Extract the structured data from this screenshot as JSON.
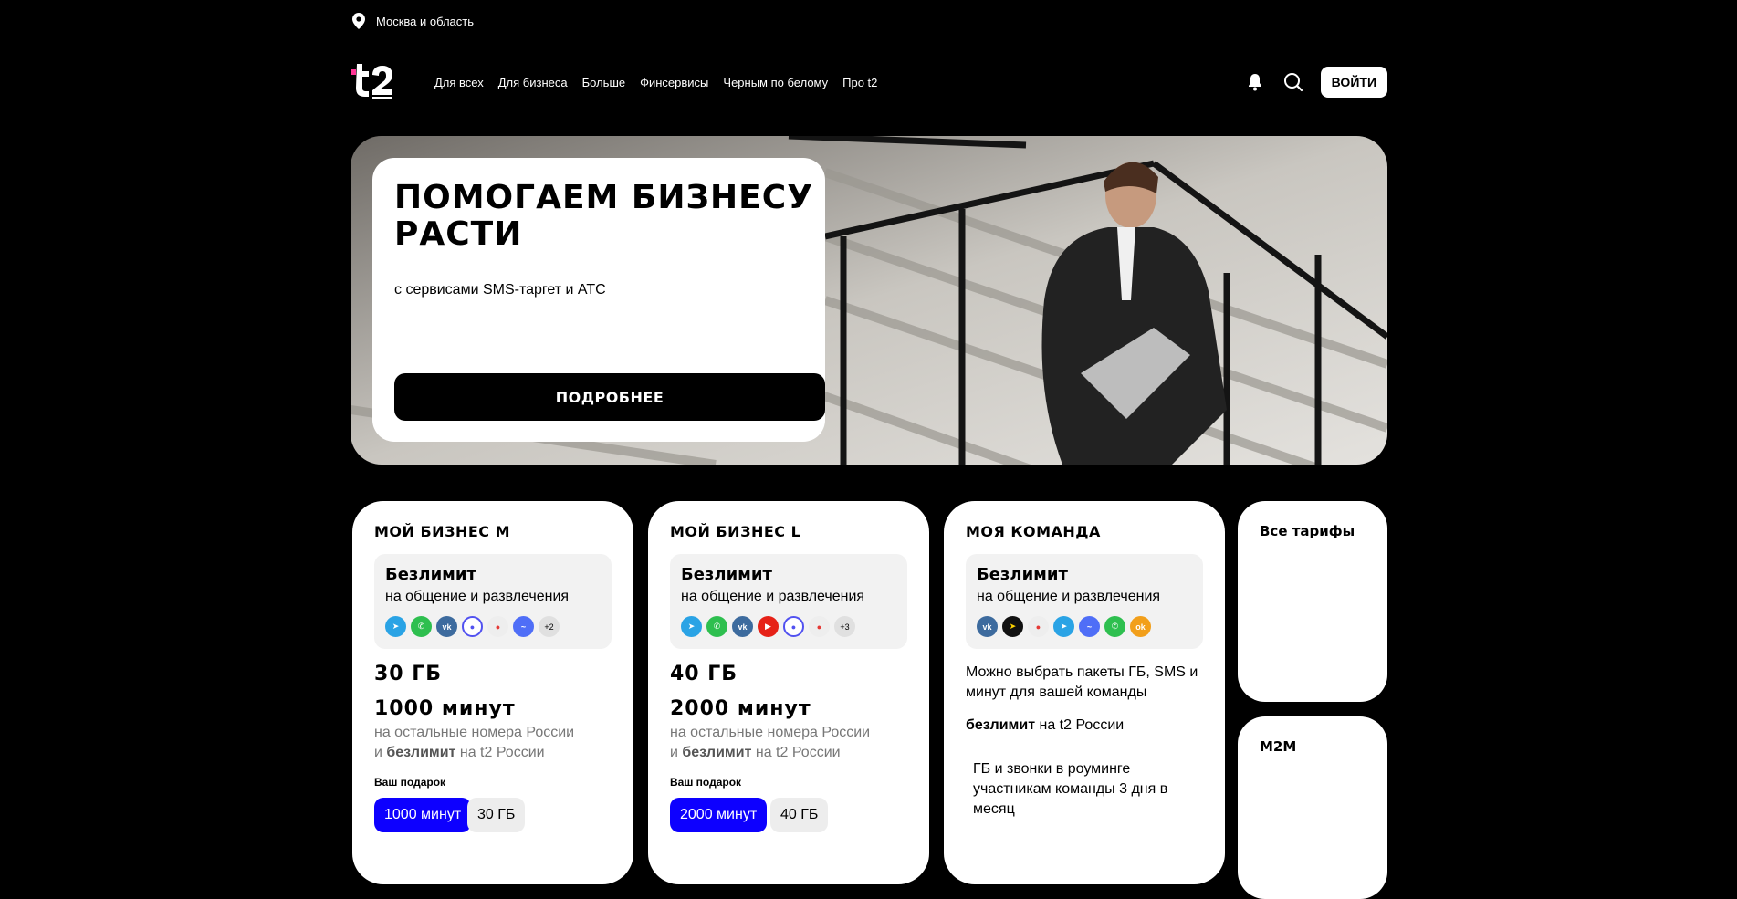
{
  "region": {
    "label": "Москва и область"
  },
  "header": {
    "nav": [
      "Для всех",
      "Для бизнеса",
      "Больше",
      "Финсервисы",
      "Черным по белому",
      "Про t2"
    ],
    "login_label": "ВОЙТИ",
    "icons": [
      "location-pin-icon",
      "t2-logo",
      "bell-icon",
      "search-icon"
    ]
  },
  "hero": {
    "title": "ПОМОГАЕМ БИЗНЕСУ РАСТИ",
    "subtitle": "с сервисами SMS-таргет и АТС",
    "button": "ПОДРОБНЕЕ"
  },
  "tariffs": [
    {
      "name": "МОЙ БИЗНЕС М",
      "unlim_title": "Безлимит",
      "unlim_sub": "на общение и развлечения",
      "apps": [
        "telegram",
        "whatsapp",
        "vk",
        "max",
        "maps",
        "messenger"
      ],
      "apps_more": "+2",
      "gb": "30 ГБ",
      "minutes": "1000 минут",
      "minutes_desc_1": "на остальные номера России",
      "minutes_desc_2a": "и ",
      "minutes_desc_bold": "безлимит",
      "minutes_desc_2b": " на t2 России",
      "gift_label": "Ваш подарок",
      "gift_a": "1000 минут",
      "gift_b": "30 ГБ"
    },
    {
      "name": "МОЙ БИЗНЕС L",
      "unlim_title": "Безлимит",
      "unlim_sub": "на общение и развлечения",
      "apps": [
        "telegram",
        "whatsapp",
        "vk",
        "youtube",
        "max",
        "maps"
      ],
      "apps_more": "+3",
      "gb": "40 ГБ",
      "minutes": "2000 минут",
      "minutes_desc_1": "на остальные номера России",
      "minutes_desc_2a": "и ",
      "minutes_desc_bold": "безлимит",
      "minutes_desc_2b": " на t2 России",
      "gift_label": "Ваш подарок",
      "gift_a": "2000 минут",
      "gift_b": "40 ГБ"
    },
    {
      "name": "МОЯ КОМАНДА",
      "unlim_title": "Безлимит",
      "unlim_sub": "на общение и развлечения",
      "apps": [
        "vk",
        "navigator",
        "maps",
        "telegram",
        "messenger",
        "whatsapp",
        "ok"
      ],
      "text": "Можно выбрать пакеты ГБ, SMS и минут для вашей команды",
      "unlim_bold": "безлимит",
      "unlim_rest": " на t2 России",
      "roaming": "ГБ и звонки в роуминге участникам команды 3 дня в месяц"
    }
  ],
  "side": {
    "all_tariffs": "Все тарифы",
    "m2m": "M2M"
  },
  "colors": {
    "accent": "#ff3495",
    "gift_blue": "#0d00ff"
  }
}
